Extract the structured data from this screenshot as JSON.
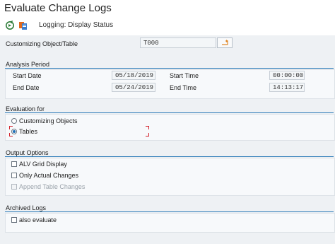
{
  "window": {
    "title": "Evaluate Change Logs"
  },
  "toolbar": {
    "execute_icon": "execute-icon",
    "variant_icon": "variant-icon",
    "logging_text": "Logging: Display Status"
  },
  "customizing": {
    "label": "Customizing Object/Table",
    "value": "T000"
  },
  "analysis_period": {
    "title": "Analysis Period",
    "start_date_label": "Start Date",
    "start_date": "05/18/2019",
    "start_time_label": "Start Time",
    "start_time": "00:00:00",
    "end_date_label": "End Date",
    "end_date": "05/24/2019",
    "end_time_label": "End Time",
    "end_time": "14:13:17"
  },
  "evaluation_for": {
    "title": "Evaluation for",
    "options": [
      "Customizing Objects",
      "Tables"
    ],
    "selected": "Tables"
  },
  "output_options": {
    "title": "Output Options",
    "alv_grid": "ALV Grid Display",
    "only_actual": "Only Actual Changes",
    "append_table": "Append Table Changes"
  },
  "archived_logs": {
    "title": "Archived Logs",
    "also_evaluate": "also evaluate"
  },
  "colors": {
    "accent": "#2a7ab8",
    "focus": "#d3202a",
    "pane_bg": "#eef1f4"
  }
}
